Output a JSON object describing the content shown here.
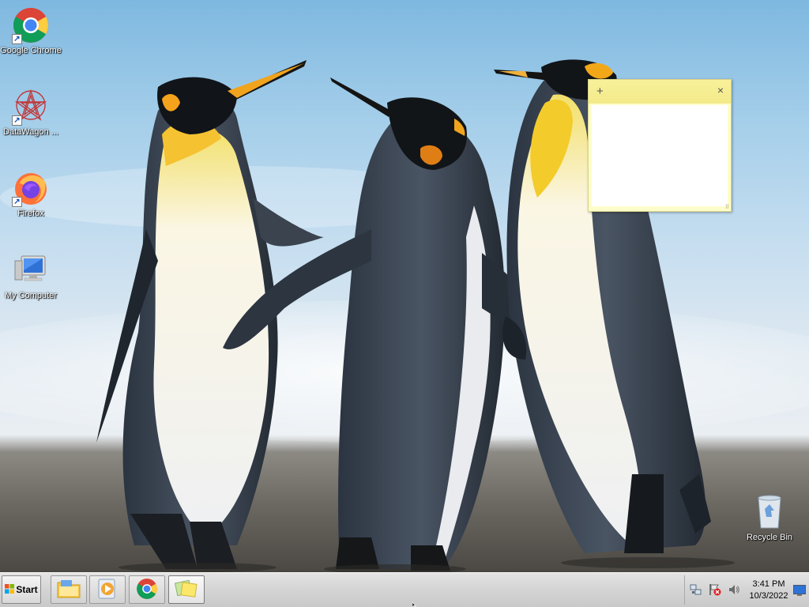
{
  "desktop": {
    "icons": [
      {
        "label": "Google Chrome",
        "icon": "chrome-icon"
      },
      {
        "label": "DataWagon ...",
        "icon": "datawagon-icon"
      },
      {
        "label": "Firefox",
        "icon": "firefox-icon"
      },
      {
        "label": "My Computer",
        "icon": "computer-icon"
      }
    ],
    "recycle_bin": {
      "label": "Recycle Bin",
      "icon": "recycle-bin-icon"
    }
  },
  "sticky_note": {
    "add_glyph": "+",
    "close_glyph": "×",
    "text": ""
  },
  "taskbar": {
    "start_label": "Start",
    "apps": [
      {
        "name": "file-explorer",
        "icon": "folder-icon",
        "active": false
      },
      {
        "name": "media-player",
        "icon": "media-player-icon",
        "active": false
      },
      {
        "name": "google-chrome",
        "icon": "chrome-icon",
        "active": false
      },
      {
        "name": "sticky-notes",
        "icon": "sticky-notes-icon",
        "active": true
      }
    ],
    "tray": {
      "icons": [
        "network-icon",
        "action-center-flag-icon",
        "volume-icon"
      ],
      "time": "3:41 PM",
      "date": "10/3/2022"
    }
  },
  "colors": {
    "sticky_bar": "#f6ee92",
    "sticky_body": "#ffffff",
    "taskbar": "#d4d4d4"
  }
}
